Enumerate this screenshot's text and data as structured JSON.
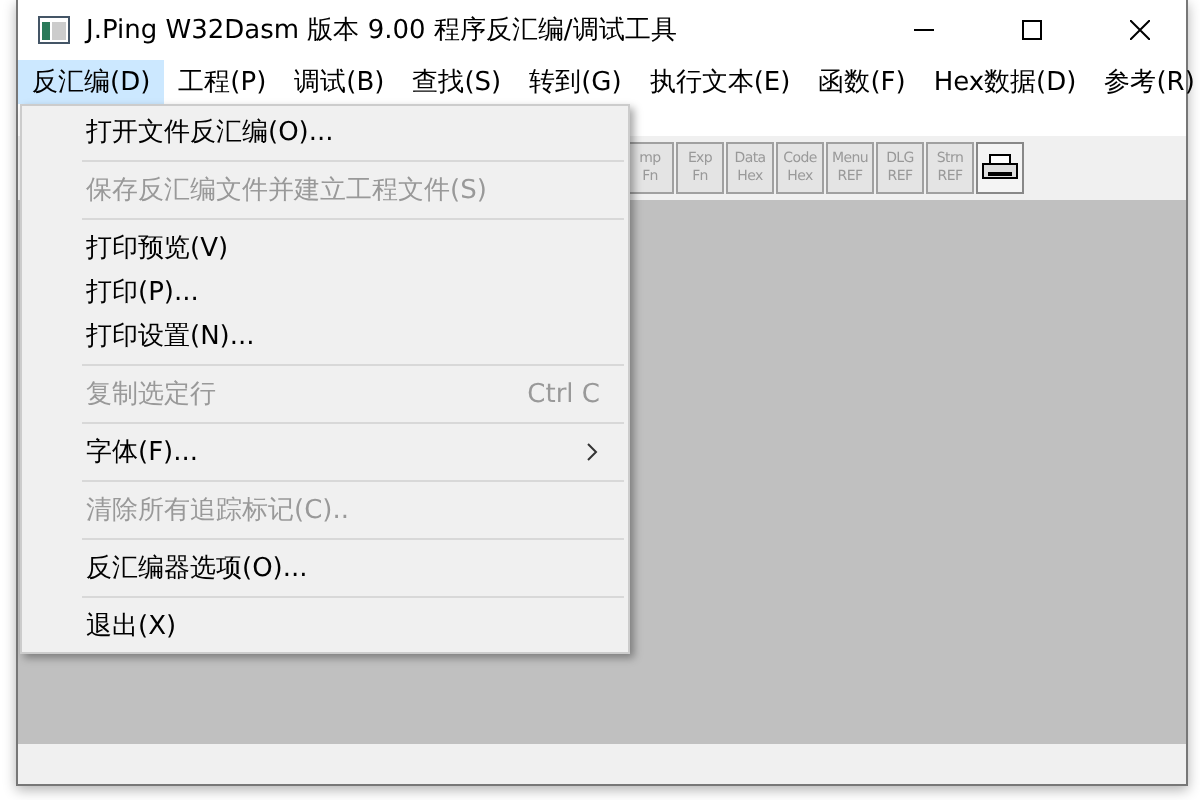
{
  "window": {
    "title": "J.Ping W32Dasm 版本 9.00 程序反汇编/调试工具"
  },
  "menu_bar": [
    {
      "label": "反汇编(D)",
      "selected": true
    },
    {
      "label": "工程(P)",
      "selected": false
    },
    {
      "label": "调试(B)",
      "selected": false
    },
    {
      "label": "查找(S)",
      "selected": false
    },
    {
      "label": "转到(G)",
      "selected": false
    },
    {
      "label": "执行文本(E)",
      "selected": false
    },
    {
      "label": "函数(F)",
      "selected": false
    },
    {
      "label": "Hex数据(D)",
      "selected": false
    },
    {
      "label": "参考(R)",
      "selected": false
    }
  ],
  "toolbar": [
    {
      "kind": "text",
      "top": "mp",
      "bottom": "Fn"
    },
    {
      "kind": "text",
      "top": "Exp",
      "bottom": "Fn"
    },
    {
      "kind": "text",
      "top": "Data",
      "bottom": "Hex"
    },
    {
      "kind": "text",
      "top": "Code",
      "bottom": "Hex"
    },
    {
      "kind": "text",
      "top": "Menu",
      "bottom": "REF"
    },
    {
      "kind": "text",
      "top": "DLG",
      "bottom": "REF"
    },
    {
      "kind": "text",
      "top": "Strn",
      "bottom": "REF"
    },
    {
      "kind": "printer"
    }
  ],
  "dropdown": [
    {
      "kind": "item",
      "label": "打开文件反汇编(O)...",
      "disabled": false
    },
    {
      "kind": "separator"
    },
    {
      "kind": "item",
      "label": "保存反汇编文件并建立工程文件(S)",
      "disabled": true
    },
    {
      "kind": "separator"
    },
    {
      "kind": "item",
      "label": "打印预览(V)",
      "disabled": false
    },
    {
      "kind": "item",
      "label": "打印(P)...",
      "disabled": false
    },
    {
      "kind": "item",
      "label": "打印设置(N)...",
      "disabled": false
    },
    {
      "kind": "separator"
    },
    {
      "kind": "item",
      "label": "复制选定行",
      "disabled": true,
      "shortcut": "Ctrl C"
    },
    {
      "kind": "separator"
    },
    {
      "kind": "item",
      "label": "字体(F)...",
      "disabled": false,
      "submenu": true
    },
    {
      "kind": "separator"
    },
    {
      "kind": "item",
      "label": "清除所有追踪标记(C)..",
      "disabled": true
    },
    {
      "kind": "separator"
    },
    {
      "kind": "item",
      "label": "反汇编器选项(O)...",
      "disabled": false
    },
    {
      "kind": "separator"
    },
    {
      "kind": "item",
      "label": "退出(X)",
      "disabled": false
    }
  ]
}
